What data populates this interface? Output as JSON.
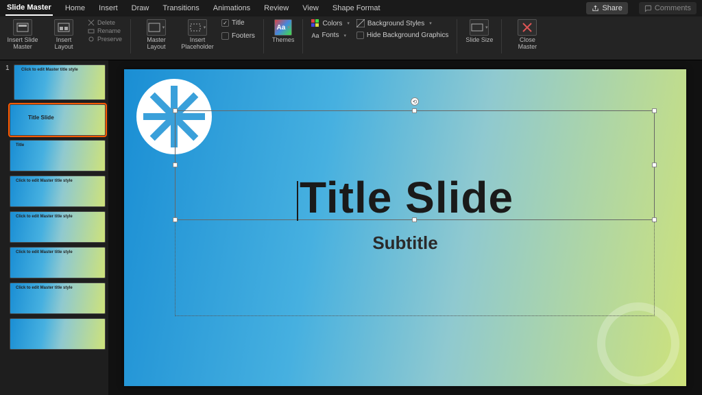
{
  "tabs": {
    "items": [
      "Slide Master",
      "Home",
      "Insert",
      "Draw",
      "Transitions",
      "Animations",
      "Review",
      "View",
      "Shape Format"
    ],
    "active": 0
  },
  "topright": {
    "share": "Share",
    "comments": "Comments"
  },
  "ribbon": {
    "insert_master": "Insert Slide Master",
    "insert_layout": "Insert Layout",
    "delete": "Delete",
    "rename": "Rename",
    "preserve": "Preserve",
    "master_layout": "Master Layout",
    "insert_placeholder": "Insert Placeholder",
    "title_chk": "Title",
    "footers_chk": "Footers",
    "themes": "Themes",
    "colors": "Colors",
    "fonts": "Fonts",
    "bg_styles": "Background Styles",
    "hide_bg": "Hide Background Graphics",
    "slide_size": "Slide Size",
    "close_master": "Close Master"
  },
  "thumbs": {
    "num": "1",
    "master": "Click to edit Master title style",
    "layouts": [
      "Title Slide",
      "Title",
      "Click to edit Master title style",
      "Click to edit Master title style",
      "Click to edit Master title style",
      "Click to edit Master title style",
      ""
    ],
    "selected": 0
  },
  "slide": {
    "title": "Title Slide",
    "subtitle": "Subtitle"
  }
}
